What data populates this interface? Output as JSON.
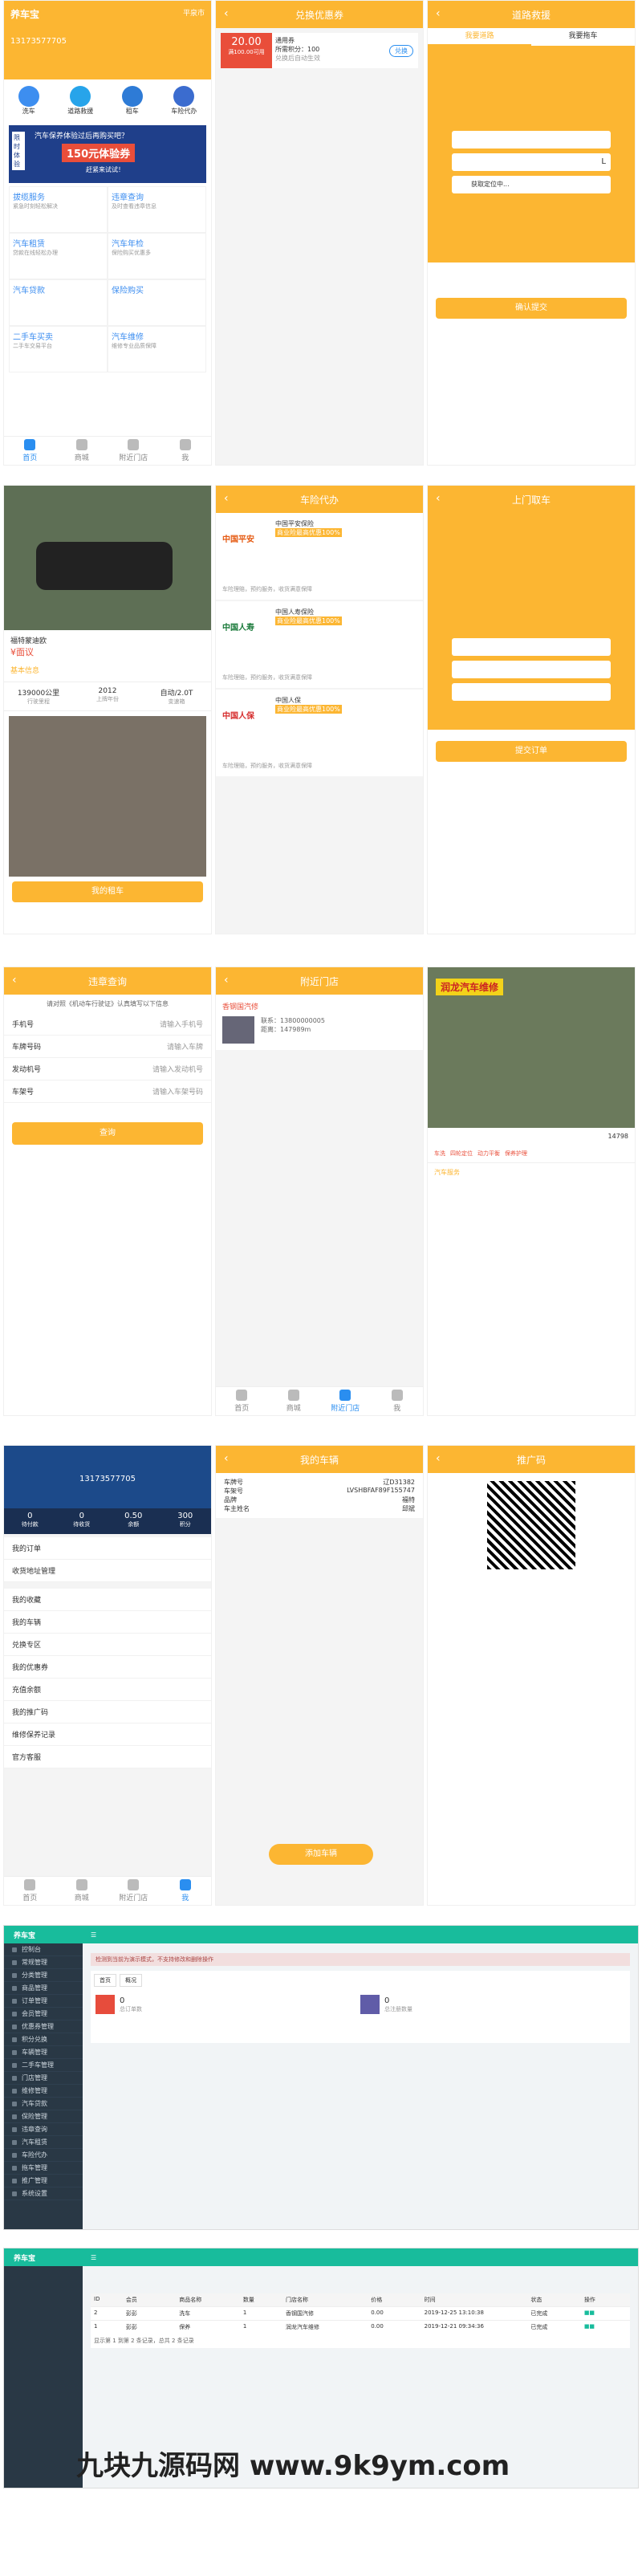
{
  "phone1": {
    "logo": "养车宝",
    "city": "平泉市",
    "phone": "13173577705",
    "icons": [
      "洗车",
      "道路救援",
      "租车",
      "车险代办"
    ],
    "banner_big": "150元体验券",
    "banner_line": "汽车保养体验过后再购买吧？",
    "banner_small": "赶紧来试试！",
    "banner_tag": "限时体验",
    "cards": [
      {
        "t": "拔缆服务",
        "s": "紧急时刻轻松解决"
      },
      {
        "t": "违章查询",
        "s": "及时查看违章信息"
      },
      {
        "t": "汽车贷款",
        "s": "贷款在线轻松办理"
      },
      {
        "t": "保险购买",
        "s": "保险购买优惠多"
      },
      {
        "t": "二手车买卖",
        "s": "二手车交易平台"
      },
      {
        "t": "汽车维修",
        "s": "维修专业品质保障"
      },
      {
        "t": "汽车租赁",
        "s": ""
      },
      {
        "t": "汽车年检",
        "s": ""
      }
    ],
    "tabs": [
      "首页",
      "商城",
      "附近门店",
      "我"
    ]
  },
  "phone2": {
    "title": "兑换优惠券",
    "price": "20.00",
    "cond": "满100.00可用",
    "name": "通用券",
    "threshold": "所需积分：100",
    "time": "兑换后自动生效",
    "btn": "兑换"
  },
  "phone3": {
    "title": "道路救援",
    "tabs": [
      "我要道路",
      "我要拖车"
    ],
    "f1": "",
    "f2": "",
    "f2u": "L",
    "f3": "获取定位中...",
    "btn": "确认提交"
  },
  "phone4": {
    "car_name": "福特蒙迪欧",
    "price": "¥面议",
    "sub": "基本信息",
    "stats": [
      {
        "v": "139000公里",
        "l": "行驶里程"
      },
      {
        "v": "2012",
        "l": "上牌年份"
      },
      {
        "v": "自动/2.0T",
        "l": "变速箱"
      }
    ],
    "btn": "我的租车"
  },
  "phone5": {
    "title": "车险代办",
    "items": [
      {
        "n": "中国平安保险",
        "t": "商业险最高优惠100%",
        "d": "车险理赔，预约服务，收货满意保障"
      },
      {
        "n": "中国人寿保险",
        "t": "商业险最高优惠100%",
        "d": "车险理赔，预约服务，收货满意保障"
      },
      {
        "n": "中国人保",
        "t": "商业险最高优惠100%",
        "d": "车险理赔，预约服务，收货满意保障"
      }
    ],
    "logos": [
      "中国平安",
      "中国人寿",
      "中国人保"
    ]
  },
  "phone6": {
    "title": "上门取车",
    "btn": "提交订单"
  },
  "phone7": {
    "title": "违章查询",
    "note": "请对照《机动车行驶证》认真填写以下信息",
    "rows": [
      {
        "l": "手机号",
        "p": "请输入手机号"
      },
      {
        "l": "车牌号码",
        "p": "请输入车牌"
      },
      {
        "l": "发动机号",
        "p": "请输入发动机号"
      },
      {
        "l": "车架号",
        "p": "请输入车架号码"
      }
    ],
    "btn": "查询"
  },
  "phone8": {
    "title": "附近门店",
    "shop": "香钢国汽修",
    "contact": "联系：13800000005",
    "dist": "距离：147989m",
    "tabs": [
      "首页",
      "商城",
      "附近门店",
      "我"
    ]
  },
  "phone9": {
    "sign": "润龙汽车维修",
    "phone": "14798",
    "tags": [
      "车洗",
      "四轮定位",
      "动力平衡",
      "保养护理"
    ],
    "more": "汽车服务"
  },
  "phone10": {
    "phone": "13173577705",
    "stats": [
      {
        "v": "0",
        "l": "待付款"
      },
      {
        "v": "0",
        "l": "待收货"
      },
      {
        "v": "0.50",
        "l": "余额"
      },
      {
        "v": "300",
        "l": "积分"
      }
    ],
    "menu": [
      "我的订单",
      "收货地址管理",
      "我的收藏",
      "我的车辆",
      "兑换专区",
      "我的优惠券",
      "充值余额",
      "我的推广码",
      "维修保养记录",
      "官方客服"
    ],
    "tabs": [
      "首页",
      "商城",
      "附近门店",
      "我"
    ]
  },
  "phone11": {
    "title": "我的车辆",
    "rows": [
      {
        "l": "车牌号",
        "v": "辽D31382"
      },
      {
        "l": "车架号",
        "v": "LVSHBFAF89F155747"
      },
      {
        "l": "品牌",
        "v": "福特"
      },
      {
        "l": "车主姓名",
        "v": "邱斌"
      }
    ],
    "btn": "添加车辆"
  },
  "phone12": {
    "title": "推广码"
  },
  "admin1": {
    "brand": "养车宝",
    "alert": "检测到当前为演示模式，不支持修改和删除操作",
    "tabs": [
      "首页",
      "概况"
    ],
    "kpi": [
      {
        "v": "0",
        "l": "总订单数"
      },
      {
        "v": "0",
        "l": "总注册数量"
      }
    ],
    "menu": [
      "控制台",
      "常规管理",
      "分类管理",
      "商品管理",
      "订单管理",
      "会员管理",
      "优惠券管理",
      "积分兑换",
      "车辆管理",
      "二手车管理",
      "门店管理",
      "维修管理",
      "汽车贷款",
      "保险管理",
      "违章查询",
      "汽车租赁",
      "车险代办",
      "拖车管理",
      "推广管理",
      "系统设置"
    ]
  },
  "admin2": {
    "brand": "养车宝",
    "cols": [
      "ID",
      "会员",
      "商品名称",
      "数量",
      "门店名称",
      "价格",
      "时间",
      "状态",
      "操作"
    ],
    "rows": [
      {
        "id": "2",
        "user": "彭彭",
        "name": "洗车",
        "num": "1",
        "shop": "香钢国汽修",
        "price": "0.00",
        "time": "2019-12-25 13:10:38",
        "st": "已完成"
      },
      {
        "id": "1",
        "user": "彭彭",
        "name": "保养",
        "num": "1",
        "shop": "润龙汽车维修",
        "price": "0.00",
        "time": "2019-12-21 09:34:36",
        "st": "已完成"
      }
    ],
    "foot": "显示第 1 到第 2 条记录，总共 2 条记录"
  },
  "watermark": "九块九源码网 www.9k9ym.com"
}
